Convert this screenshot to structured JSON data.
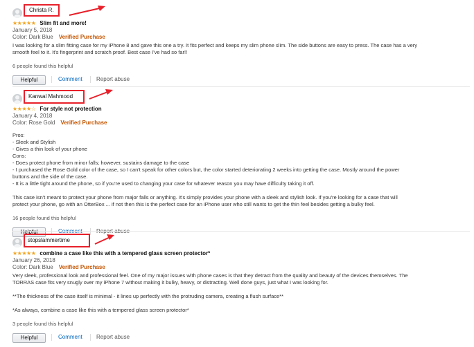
{
  "reviews": [
    {
      "name": "Christa R.",
      "stars": "★★★★★",
      "rating": 5,
      "title": "Slim fit and more!",
      "date": "January 5, 2018",
      "color": "Color: Dark Blue",
      "verified": "Verified Purchase",
      "body": [
        "I was looking for a slim fitting case for my iPhone 8 and gave this one a try. It fits perfect and keeps my slim phone slim. The side buttons are easy to press. The case has a very",
        "smooth feel to it. It's fingerprint and scratch proof. Best case I've had so far!!"
      ],
      "helpful_count": "6 people found this helpful",
      "helpful_label": "Helpful",
      "comment_label": "Comment",
      "report_label": "Report abuse"
    },
    {
      "name": "Kanwal Mahmood",
      "stars": "★★★★☆",
      "rating": 4,
      "title": "For style not protection",
      "date": "January 4, 2018",
      "color": "Color: Rose Gold",
      "verified": "Verified Purchase",
      "body": [
        "Pros:",
        "- Sleek and Stylish",
        "- Gives a thin look of your phone",
        "Cons:",
        "- Does protect phone from minor falls; however, sustains damage to the case",
        "- I purchased the Rose Gold color of the case, so I can't speak for other colors but, the color started deteriorating 2 weeks into getting the case. Mostly around the power",
        "buttons and the side of the case.",
        "- It is a little tight around the phone, so if you're used to changing your case for whatever reason you may have difficulty taking it off.",
        "",
        "This case isn't meant to protect your phone from major falls or anything. It's simply provides your phone with a sleek and stylish look. If you're looking for a case that will",
        "protect your phone, go with an OtterBox ... if not then this is the perfect case for an iPhone user who still wants to get the thin feel besides getting a bulky feel."
      ],
      "helpful_count": "16 people found this helpful",
      "helpful_label": "Helpful",
      "comment_label": "Comment",
      "report_label": "Report abuse"
    },
    {
      "name": "stopslammertime",
      "stars": "★★★★★",
      "rating": 5,
      "title": "combine a case like this with a tempered glass screen protector*",
      "date": "January 26, 2018",
      "color": "Color: Dark Blue",
      "verified": "Verified Purchase",
      "body": [
        "Very sleek, professional look and professional feel. One of my major issues with phone cases is that they detract from the quality and beauty of the devices themselves. The",
        "TORRAS case fits very snugly over my iPhone 7 without making it bulky, heavy, or distracting. Well done guys, just what I was looking for.",
        "",
        "**The thickness of the case itself is minimal - it lines up perfectly with the protruding camera, creating a flush surface**",
        "",
        "*As always, combine a case like this with a tempered glass screen protector*"
      ],
      "helpful_count": "3 people found this helpful",
      "helpful_label": "Helpful",
      "comment_label": "Comment",
      "report_label": "Report abuse"
    }
  ],
  "colors": {
    "annotation": "#e8202a",
    "star": "#f4a41d",
    "verified": "#c45500",
    "link": "#0066c0"
  }
}
